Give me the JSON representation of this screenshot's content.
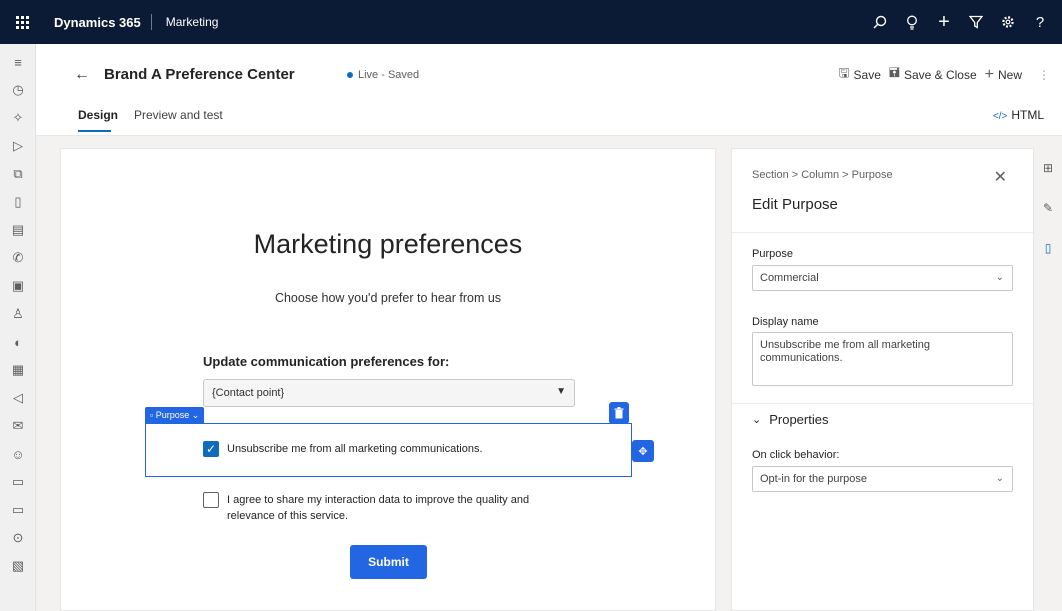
{
  "topbar": {
    "brand": "Dynamics 365",
    "app": "Marketing"
  },
  "page": {
    "title": "Brand A Preference Center",
    "status": "Live - Saved"
  },
  "commands": {
    "save": "Save",
    "save_close": "Save & Close",
    "new": "New"
  },
  "tabs": [
    {
      "label": "Design"
    },
    {
      "label": "Preview and test"
    }
  ],
  "html_toggle": "HTML",
  "form": {
    "title": "Marketing preferences",
    "subtitle": "Choose how you'd prefer to hear from us",
    "update_label": "Update communication preferences for:",
    "contact_point": "{Contact point}",
    "purpose_tag": "Purpose",
    "unsubscribe_text": "Unsubscribe me from all marketing communications.",
    "unsubscribe_checked": true,
    "consent_line1": "I agree to share my interaction data to improve the quality and",
    "consent_line2": "relevance of this service.",
    "consent_checked": false,
    "submit": "Submit"
  },
  "panel": {
    "breadcrumb": "Section > Column > Purpose",
    "title": "Edit Purpose",
    "purpose_label": "Purpose",
    "purpose_value": "Commercial",
    "display_name_label": "Display name",
    "display_name_value": "Unsubscribe me from all marketing communications.",
    "properties_label": "Properties",
    "on_click_label": "On click behavior:",
    "on_click_value": "Opt-in for the purpose"
  },
  "colors": {
    "accent": "#2266e3",
    "topbar": "#0b1a35"
  }
}
